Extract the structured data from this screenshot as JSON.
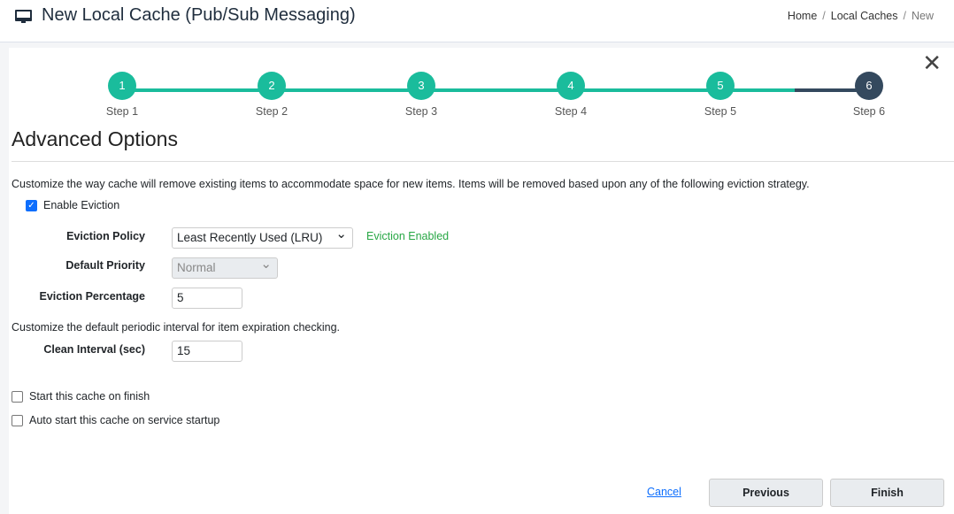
{
  "header": {
    "title": "New Local Cache (Pub/Sub Messaging)",
    "breadcrumb": [
      "Home",
      "Local Caches",
      "New"
    ],
    "separator": "/"
  },
  "wizard": {
    "steps": [
      {
        "num": "1",
        "label": "Step 1"
      },
      {
        "num": "2",
        "label": "Step 2"
      },
      {
        "num": "3",
        "label": "Step 3"
      },
      {
        "num": "4",
        "label": "Step 4"
      },
      {
        "num": "5",
        "label": "Step 5"
      },
      {
        "num": "6",
        "label": "Step 6"
      }
    ],
    "current_step": 6,
    "colors": {
      "done": "#1abc9c",
      "active": "#34495e"
    }
  },
  "section": {
    "title": "Advanced Options",
    "eviction_desc": "Customize the way cache will remove existing items to accommodate space for new items. Items will be removed based upon any of the following eviction strategy.",
    "enable_eviction": {
      "label": "Enable Eviction",
      "checked": true
    },
    "eviction_policy": {
      "label": "Eviction Policy",
      "value": "Least Recently Used (LRU)",
      "status": "Eviction Enabled",
      "status_color": "#28a745"
    },
    "default_priority": {
      "label": "Default Priority",
      "value": "Normal",
      "disabled": true
    },
    "eviction_percentage": {
      "label": "Eviction Percentage",
      "value": "5"
    },
    "clean_desc": "Customize the default periodic interval for item expiration checking.",
    "clean_interval": {
      "label": "Clean Interval (sec)",
      "value": "15"
    },
    "start_on_finish": {
      "label": "Start this cache on finish",
      "checked": false
    },
    "auto_start": {
      "label": "Auto start this cache on service startup",
      "checked": false
    }
  },
  "footer": {
    "cancel": "Cancel",
    "previous": "Previous",
    "finish": "Finish"
  }
}
